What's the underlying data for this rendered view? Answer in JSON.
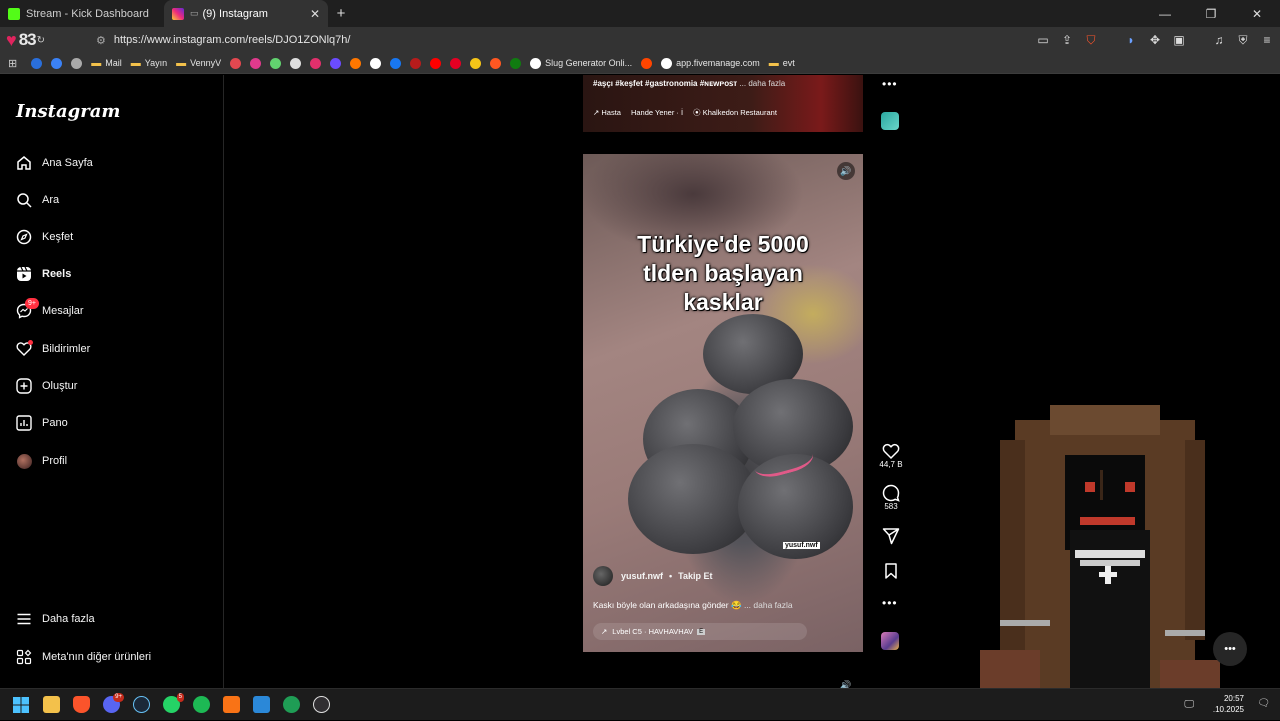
{
  "browser": {
    "tabs": [
      {
        "title": "Stream - Kick Dashboard",
        "favicon_color": "#53fc18",
        "active": false
      },
      {
        "title": "(9) Instagram",
        "favicon_color": "#e1306c",
        "active": true
      }
    ],
    "new_tab": "+",
    "address": {
      "counter": "83",
      "url": "https://www.instagram.com/reels/DJO1ZONlq7h/"
    },
    "bookmarks": [
      {
        "label": "",
        "icon": "zte-icon",
        "color": "#2a6fdb"
      },
      {
        "label": "",
        "icon": "play-icon",
        "color": "#3b82f6"
      },
      {
        "label": "",
        "icon": "circle-icon",
        "color": "#aaaaaa"
      },
      {
        "label": "Mail",
        "icon": "folder-icon",
        "color": "#f3c14b"
      },
      {
        "label": "Yayın",
        "icon": "folder-icon",
        "color": "#f3c14b"
      },
      {
        "label": "VennyV",
        "icon": "folder-icon",
        "color": "#f3c14b"
      },
      {
        "label": "",
        "icon": "adobe-icon",
        "color": "#e34850"
      },
      {
        "label": "",
        "icon": "bi-icon",
        "color": "#e03a8c"
      },
      {
        "label": "",
        "icon": "star-icon",
        "color": "#62d26f"
      },
      {
        "label": "",
        "icon": "reddit-icon",
        "color": "#dddddd"
      },
      {
        "label": "",
        "icon": "instagram-icon",
        "color": "#e1306c"
      },
      {
        "label": "",
        "icon": "circle-icon",
        "color": "#6b4cff"
      },
      {
        "label": "",
        "icon": "soundcloud-icon",
        "color": "#ff7700"
      },
      {
        "label": "",
        "icon": "x-icon",
        "color": "#ffffff"
      },
      {
        "label": "",
        "icon": "circle-icon",
        "color": "#1877f2"
      },
      {
        "label": "",
        "icon": "circle-icon",
        "color": "#b71c1c"
      },
      {
        "label": "",
        "icon": "youtube-icon",
        "color": "#ff0000"
      },
      {
        "label": "",
        "icon": "pinterest-icon",
        "color": "#e60023"
      },
      {
        "label": "",
        "icon": "circle-icon",
        "color": "#f5c518"
      },
      {
        "label": "",
        "icon": "circle-icon",
        "color": "#ff5722"
      },
      {
        "label": "",
        "icon": "xbox-icon",
        "color": "#107c10"
      },
      {
        "label": "Slug Generator Onli...",
        "icon": "a-icon",
        "color": "#ffffff"
      },
      {
        "label": "",
        "icon": "reddit-icon",
        "color": "#ff4500"
      },
      {
        "label": "app.fivemanage.com",
        "icon": "f-icon",
        "color": "#ffffff"
      },
      {
        "label": "evt",
        "icon": "folder-icon",
        "color": "#f3c14b"
      }
    ]
  },
  "instagram": {
    "logo": "Instagram",
    "nav": [
      {
        "key": "home",
        "label": "Ana Sayfa",
        "icon": "home-icon"
      },
      {
        "key": "search",
        "label": "Ara",
        "icon": "search-icon"
      },
      {
        "key": "explore",
        "label": "Keşfet",
        "icon": "compass-icon"
      },
      {
        "key": "reels",
        "label": "Reels",
        "icon": "reels-icon"
      },
      {
        "key": "messages",
        "label": "Mesajlar",
        "icon": "messenger-icon",
        "badge": "9+"
      },
      {
        "key": "notifications",
        "label": "Bildirimler",
        "icon": "heart-icon"
      },
      {
        "key": "create",
        "label": "Oluştur",
        "icon": "plus-square-icon"
      },
      {
        "key": "dashboard",
        "label": "Pano",
        "icon": "dashboard-icon"
      },
      {
        "key": "profile",
        "label": "Profil",
        "icon": "avatar"
      }
    ],
    "more": "Daha fazla",
    "meta": "Meta'nın diğer ürünleri",
    "prev_reel": {
      "tags": "#aşçı #keşfet #gastronomia #ɴᴇᴡᴘᴏꜱᴛ",
      "more": "... daha fazla",
      "audio_1": "Hasta",
      "audio_2": "Hande Yener · İ",
      "location": "Khalkedon Restaurant"
    },
    "reel": {
      "caption_line1": "Türkiye'de 5000",
      "caption_line2": "tlden başlayan",
      "caption_line3": "kasklar",
      "watermark": "yusuf.nwf",
      "author": "yusuf.nwf",
      "dot": "•",
      "follow": "Takip Et",
      "description": "Kaskı böyle olan arkadaşına gönder 😂",
      "desc_more": "... daha fazla",
      "music": "Lvbel C5 · HAVHAVHAV"
    },
    "actions": {
      "likes": "44,7 B",
      "comments": "583"
    }
  },
  "taskbar": {
    "time": "20:57",
    "date": ".10.2025",
    "discord_badge": "9+",
    "whatsapp_badge": "5"
  }
}
